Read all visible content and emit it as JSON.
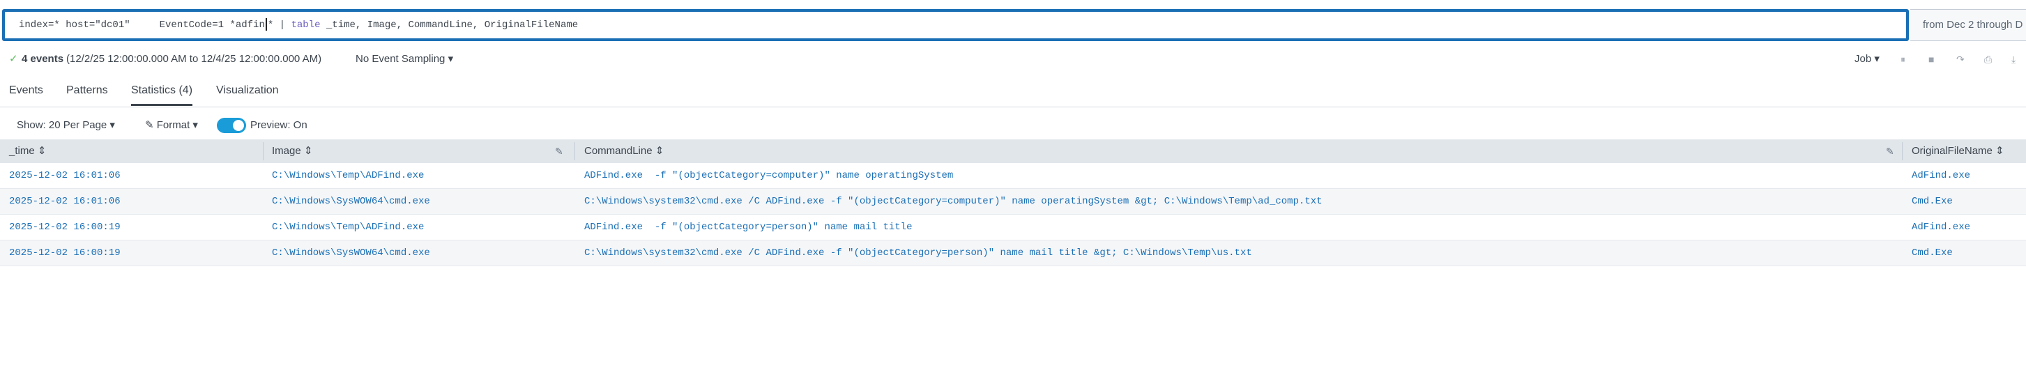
{
  "search": {
    "query_before_caret": "index=* host=\"dc01\"     EventCode=1 *adfin",
    "query_after_caret": "* | ",
    "query_keyword": "table",
    "query_rest": " _time, Image, CommandLine, OriginalFileName",
    "timerange": "from Dec 2 through D"
  },
  "status": {
    "check_icon": "✓",
    "events_count": "4 events",
    "events_range": "(12/2/25 12:00:00.000 AM to 12/4/25 12:00:00.000 AM)",
    "sampling": "No Event Sampling ▾",
    "job": "Job ▾"
  },
  "tabs": [
    "Events",
    "Patterns",
    "Statistics (4)",
    "Visualization"
  ],
  "controls": {
    "show": "Show: 20 Per Page ▾",
    "format": "✎ Format ▾",
    "preview": "Preview: On"
  },
  "table": {
    "columns": [
      "_time ⇕",
      "Image ⇕",
      "CommandLine ⇕",
      "OriginalFileName ⇕"
    ],
    "rows": [
      {
        "time": "2025-12-02 16:01:06",
        "image": "C:\\Windows\\Temp\\ADFind.exe",
        "cmd": "ADFind.exe  -f \"(objectCategory=computer)\" name operatingSystem",
        "ofn": "AdFind.exe"
      },
      {
        "time": "2025-12-02 16:01:06",
        "image": "C:\\Windows\\SysWOW64\\cmd.exe",
        "cmd": "C:\\Windows\\system32\\cmd.exe /C ADFind.exe -f \"(objectCategory=computer)\" name operatingSystem &gt; C:\\Windows\\Temp\\ad_comp.txt",
        "ofn": "Cmd.Exe"
      },
      {
        "time": "2025-12-02 16:00:19",
        "image": "C:\\Windows\\Temp\\ADFind.exe",
        "cmd": "ADFind.exe  -f \"(objectCategory=person)\" name mail title",
        "ofn": "AdFind.exe"
      },
      {
        "time": "2025-12-02 16:00:19",
        "image": "C:\\Windows\\SysWOW64\\cmd.exe",
        "cmd": "C:\\Windows\\system32\\cmd.exe /C ADFind.exe -f \"(objectCategory=person)\" name mail title &gt; C:\\Windows\\Temp\\us.txt",
        "ofn": "Cmd.Exe"
      }
    ]
  }
}
